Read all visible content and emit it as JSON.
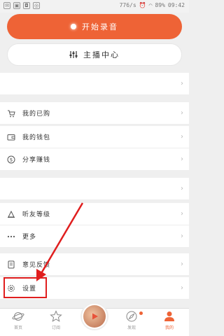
{
  "statusbar": {
    "left_icons": [
      "notification-icon",
      "image-icon",
      "bag-icon",
      "wechat-icon"
    ],
    "right_text": "776/s",
    "battery": "89%",
    "time": "09:42"
  },
  "record_button": {
    "label": "开始录音"
  },
  "anchor_button": {
    "label": "主播中心"
  },
  "menu": {
    "purchased": "我的已购",
    "wallet": "我的钱包",
    "share": "分享赚钱",
    "level": "听友等级",
    "more": "更多",
    "feedback": "意见反馈",
    "settings": "设置"
  },
  "tabs": [
    {
      "label": "首页"
    },
    {
      "label": "订阅"
    },
    {
      "label": ""
    },
    {
      "label": "发现"
    },
    {
      "label": "我的"
    }
  ],
  "colors": {
    "accent": "#ee6336",
    "highlight": "#e01e1e"
  }
}
